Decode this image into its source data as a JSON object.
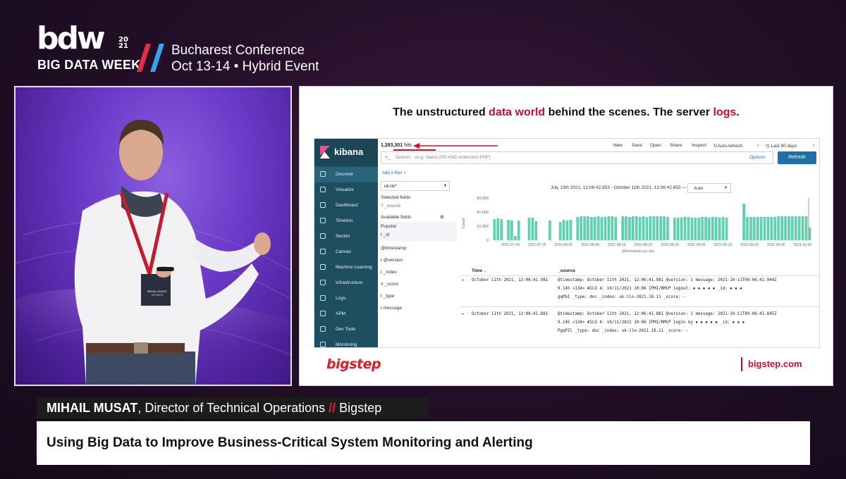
{
  "brand": {
    "logo_text": "bdw",
    "year_top": "20",
    "year_bottom": "21",
    "subtitle": "BIG DATA WEEK",
    "conference_line1": "Bucharest Conference",
    "conference_line2": "Oct 13-14 • Hybrid Event",
    "slash_colors": [
      "#e52e44",
      "#3aa3e8"
    ]
  },
  "video": {
    "lanyard_text": "MIHAIL MUSAT",
    "lanyard_subtext": "SPEAKER"
  },
  "slide": {
    "title_part1": "The unstructured ",
    "title_hl1": "data world",
    "title_part2": " behind the scenes. The server ",
    "title_hl2": "logs",
    "title_part3": ".",
    "accent_color": "#c1102d",
    "footer_logo": "bigstep",
    "footer_url": "bigstep.com"
  },
  "kibana": {
    "logo": "kibana",
    "hits_count": "1,283,301",
    "hits_label": "hits",
    "menu": [
      "New",
      "Save",
      "Open",
      "Share",
      "Inspect",
      "Auto-refresh",
      "Last 90 days"
    ],
    "search_placeholder": "Search... (e.g. status:200 AND extension:PHP)",
    "options_label": "Options",
    "refresh_label": "Refresh",
    "add_filter": "Add a filter +",
    "nav": [
      {
        "label": "Discover",
        "icon": "compass-icon"
      },
      {
        "label": "Visualize",
        "icon": "chart-icon"
      },
      {
        "label": "Dashboard",
        "icon": "dashboard-icon"
      },
      {
        "label": "Timelion",
        "icon": "timelion-icon"
      },
      {
        "label": "Sentinl",
        "icon": "alert-icon"
      },
      {
        "label": "Canvas",
        "icon": "canvas-icon"
      },
      {
        "label": "Machine Learning",
        "icon": "ml-icon"
      },
      {
        "label": "Infrastructure",
        "icon": "infra-icon"
      },
      {
        "label": "Logs",
        "icon": "logs-icon"
      },
      {
        "label": "APM",
        "icon": "apm-icon"
      },
      {
        "label": "Dev Tools",
        "icon": "wrench-icon"
      },
      {
        "label": "Monitoring",
        "icon": "heartbeat-icon"
      }
    ],
    "index_pattern": "uk-ilo*",
    "selected_fields_title": "Selected fields",
    "selected_fields": [
      "? _source"
    ],
    "available_fields_title": "Available fields",
    "popular_title": "Popular",
    "popular_fields": [
      "t _id"
    ],
    "other_fields": [
      "@timestamp",
      "t @version",
      "t _index",
      "# _score",
      "t _type",
      "t message"
    ],
    "date_range": "July 13th 2021, 12:06:42.653 - October 11th 2021, 12:06:42.653 —",
    "interval": "Auto",
    "x_axis_title": "@timestamp per day",
    "table_headers": [
      "Time",
      "_source"
    ],
    "rows": [
      {
        "time": "October 11th 2021, 12:06:41.981",
        "line1": "@timestamp: October 11th 2021, 12:06:41.981  @version: 1  message: 2021-10-11T09:06:41.944Z",
        "line2": "9.145 <134> #ILO 4: 10/11/2021 10:06 IPMI/RMCP logout:  ▪ ▪ ▪ ▪ ▪  _id:  ▪ ▪ ▪",
        "line3": "gqPbI  _type: doc  _index: uk-ilo-2021.10.11  _score: -"
      },
      {
        "time": "October 11th 2021, 12:06:41.881",
        "line1": "@timestamp: October 11th 2021, 12:06:41.881  @version: 1  message: 2021-10-11T09:06:41.845Z",
        "line2": "9.145 <134> #ILO 4: 10/11/2021 10:06 IPMI/RMCP login by  ▪ ▪ ▪ ▪ ▪  _id:  ▪ ▪ ▪",
        "line3": "PgqPZl  _type: doc  _index: uk-ilo-2021.10.11  _score: -"
      }
    ]
  },
  "chart_data": {
    "type": "bar",
    "title": "",
    "xlabel": "@timestamp per day",
    "ylabel": "Count",
    "ylim": [
      0,
      30000
    ],
    "yticks": [
      0,
      10000,
      20000,
      30000
    ],
    "ytick_labels": [
      "0",
      "10,000",
      "20,000",
      "30,000"
    ],
    "xtick_labels": [
      "2021-07-18",
      "2021-07-25",
      "2021-08-01",
      "2021-08-08",
      "2021-08-15",
      "2021-08-22",
      "2021-08-29",
      "2021-09-05",
      "2021-09-12",
      "2021-09-19",
      "2021-09-26",
      "2021-10-03"
    ],
    "color": "#5fd0b0",
    "values": [
      15000,
      15500,
      15000,
      0,
      14500,
      14000,
      3000,
      14000,
      0,
      0,
      16000,
      16000,
      13500,
      0,
      0,
      0,
      14000,
      0,
      0,
      13000,
      14500,
      14000,
      14500,
      0,
      16500,
      17000,
      17000,
      17000,
      16500,
      16500,
      17000,
      16500,
      16500,
      17000,
      17000,
      16500,
      0,
      17000,
      17000,
      16500,
      17000,
      17000,
      16500,
      17000,
      16500,
      17000,
      17000,
      17000,
      17000,
      17000,
      16500,
      0,
      16000,
      16000,
      16000,
      16500,
      16500,
      16000,
      16000,
      16000,
      16500,
      16500,
      16000,
      16500,
      16500,
      16000,
      16500,
      16000,
      0,
      0,
      0,
      0,
      26000,
      16500,
      16500,
      16500,
      16500,
      16500,
      16500,
      16500,
      16500,
      16500,
      17000,
      17000,
      17000,
      17000,
      17000,
      17000,
      17000,
      17000,
      17000,
      9000
    ]
  },
  "lower_third": {
    "speaker_name": "MIHAIL MUSAT",
    "speaker_role": ", Director of Technical Operations",
    "separator": "//",
    "company": "Bigstep",
    "talk_title": "Using Big Data to Improve Business-Critical System Monitoring and Alerting"
  }
}
